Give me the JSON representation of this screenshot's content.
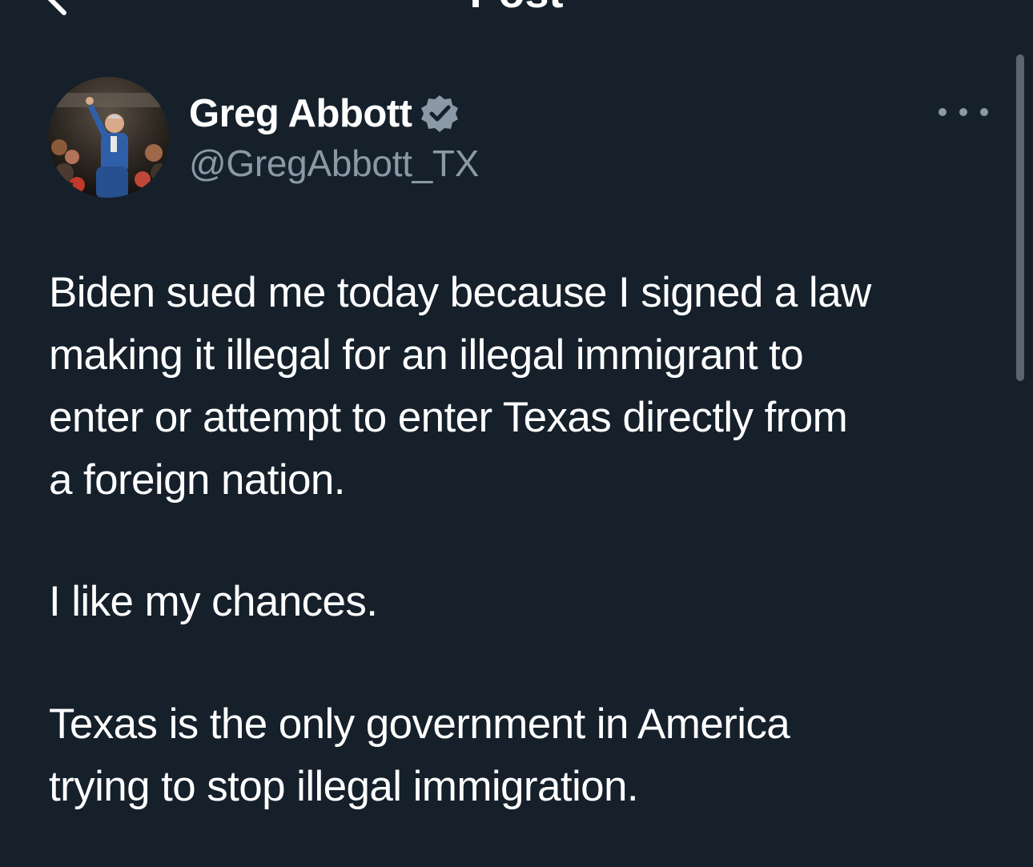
{
  "header": {
    "title": "Post",
    "back_icon": "chevron-left-icon"
  },
  "author": {
    "name": "Greg Abbott",
    "handle": "@GregAbbott_TX",
    "verified": true,
    "verified_icon": "verified-badge-icon",
    "badge_color": "#8b98a5"
  },
  "post": {
    "paragraphs": [
      {
        "lines": [
          "Biden sued me today because I signed a law",
          "making it illegal for an illegal immigrant to",
          "enter or attempt to enter Texas directly from",
          "a foreign nation."
        ]
      },
      {
        "lines": [
          "I like my chances."
        ]
      },
      {
        "lines": [
          "Texas is the only government in America",
          "trying to stop illegal immigration."
        ]
      }
    ]
  },
  "menu": {
    "more_icon": "more-horizontal-icon"
  },
  "theme": {
    "background": "#15202b",
    "text": "#ffffff",
    "secondary_text": "#8b98a5"
  }
}
